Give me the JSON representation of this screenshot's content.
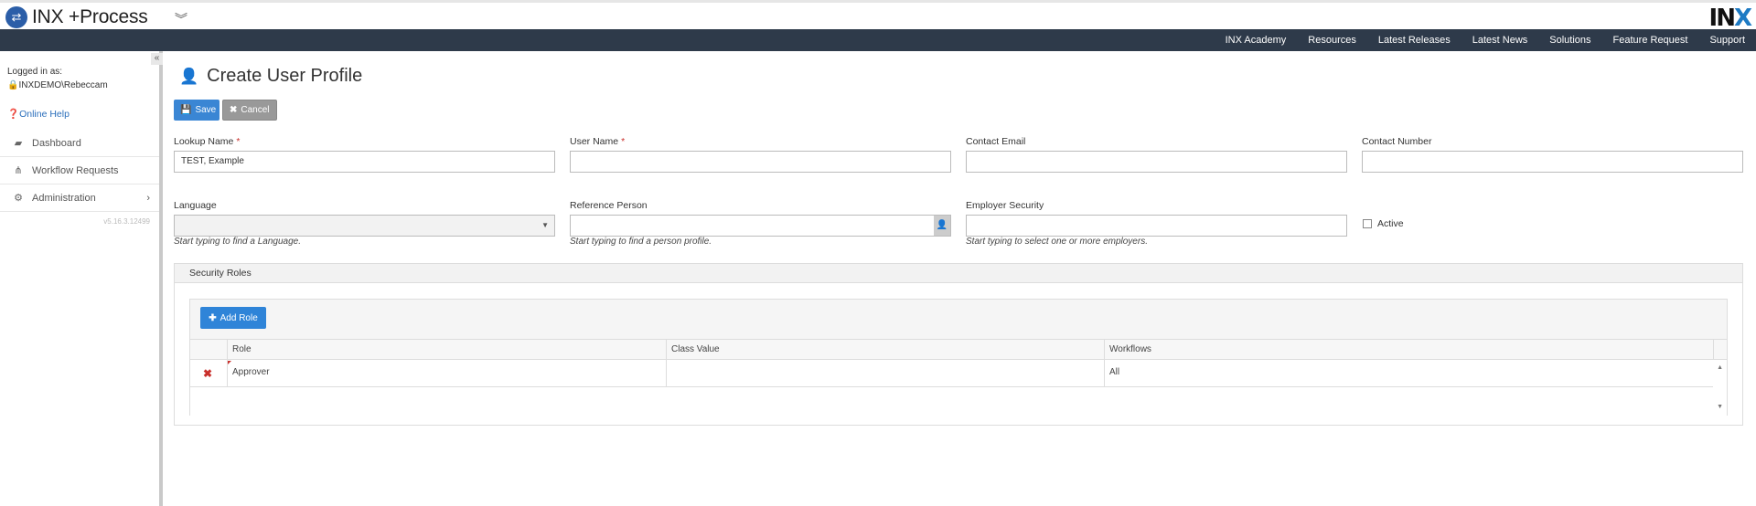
{
  "app": {
    "title": "INX +Process",
    "brand": "INX"
  },
  "nav": {
    "links": [
      "INX Academy",
      "Resources",
      "Latest Releases",
      "Latest News",
      "Solutions",
      "Feature Request",
      "Support"
    ]
  },
  "sidebar": {
    "logged_in_label": "Logged in as:",
    "user": "INXDEMO\\Rebeccam",
    "help": "Online Help",
    "items": [
      {
        "label": "Dashboard",
        "icon": "chart-icon"
      },
      {
        "label": "Workflow Requests",
        "icon": "sitemap-icon"
      },
      {
        "label": "Administration",
        "icon": "cogs-icon"
      }
    ],
    "version": "v5.16.3.12499"
  },
  "page": {
    "title": "Create User Profile",
    "save_label": "Save",
    "cancel_label": "Cancel"
  },
  "form": {
    "lookup_name": {
      "label": "Lookup Name",
      "value": "TEST, Example"
    },
    "user_name": {
      "label": "User Name",
      "value": ""
    },
    "contact_email": {
      "label": "Contact Email",
      "value": ""
    },
    "contact_number": {
      "label": "Contact Number",
      "value": ""
    },
    "language": {
      "label": "Language",
      "value": "",
      "hint": "Start typing to find a Language."
    },
    "reference_person": {
      "label": "Reference Person",
      "value": "",
      "hint": "Start typing to find a person profile."
    },
    "employer_security": {
      "label": "Employer Security",
      "value": "",
      "hint": "Start typing to select one or more employers."
    },
    "active": {
      "label": "Active",
      "checked": false
    }
  },
  "security_roles": {
    "title": "Security Roles",
    "add_label": "Add Role",
    "columns": [
      "Role",
      "Class Value",
      "Workflows"
    ],
    "rows": [
      {
        "role": "Approver",
        "class_value": "",
        "workflows": "All"
      }
    ]
  }
}
